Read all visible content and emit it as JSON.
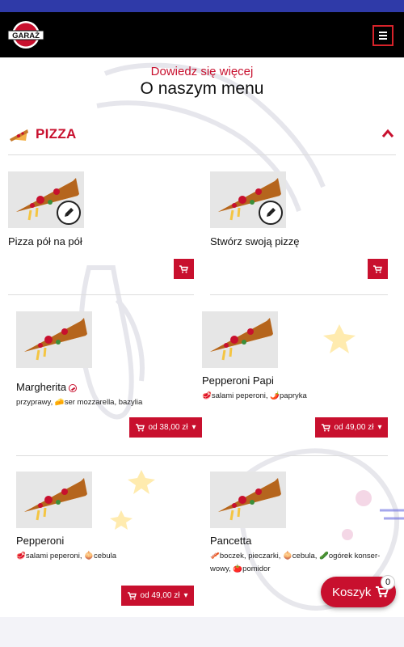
{
  "header": {
    "logo_text": "GARAŻ",
    "menu_icon": "hamburger-icon"
  },
  "intro": {
    "subtitle": "Dowiedz się więcej",
    "title": "O naszym menu"
  },
  "category": {
    "title": "PIZZA",
    "icon": "pizza-slice-icon",
    "toggle_icon": "chevron-up-icon"
  },
  "custom_items": [
    {
      "name": "Pizza pół na pół"
    },
    {
      "name": "Stwórz swoją pizzę"
    }
  ],
  "products": [
    {
      "name": "Margherita",
      "spicy": true,
      "description": "przyprawy, 🧀ser mozzarella, bazylia",
      "price": "od 38,00 zł"
    },
    {
      "name": "Pepperoni Papi",
      "spicy": false,
      "description": "🥩salami peperoni, 🌶️papryka",
      "price": "od 49,00 zł"
    },
    {
      "name": "Pepperoni",
      "spicy": false,
      "description": "🥩salami peperoni, 🧅cebula",
      "price": "od 49,00 zł"
    },
    {
      "name": "Pancetta",
      "spicy": false,
      "description": "🥓boczek, pieczarki, 🧅cebula, 🥒ogórek konser-wowy, 🍅pomidor",
      "price": ""
    }
  ],
  "cart": {
    "label": "Koszyk",
    "count": "0"
  },
  "colors": {
    "accent": "#c8102e",
    "top_strip": "#2f3aa8",
    "navbar": "#000000"
  }
}
